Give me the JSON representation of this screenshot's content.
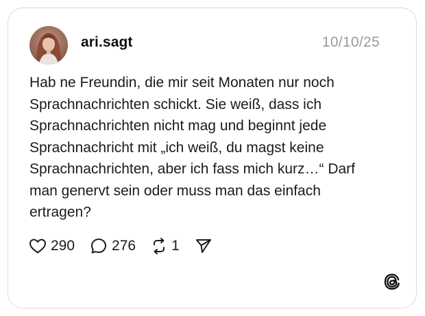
{
  "post": {
    "username": "ari.sagt",
    "date": "10/10/25",
    "text_lines": [
      "Hab ne Freundin, die mir seit Monaten nur noch",
      "Sprachnachrichten schickt. Sie weiß, dass ich",
      "Sprachnachrichten nicht mag und beginnt jede",
      "Sprachnachricht mit „ich weiß, du magst keine",
      "Sprachnachrichten, aber ich fass mich kurz…“ Darf",
      "man genervt sein oder muss man das einfach",
      "ertragen?"
    ]
  },
  "actions": {
    "likes": "290",
    "comments": "276",
    "reposts": "1",
    "like_icon": "heart-icon",
    "comment_icon": "speech-bubble-icon",
    "repost_icon": "repost-icon",
    "share_icon": "paper-plane-icon"
  },
  "branding": {
    "logo_icon": "threads-logo-icon"
  },
  "colors": {
    "text": "#1a1a1a",
    "muted": "#9a9a9a",
    "border": "#d9d9d9"
  }
}
